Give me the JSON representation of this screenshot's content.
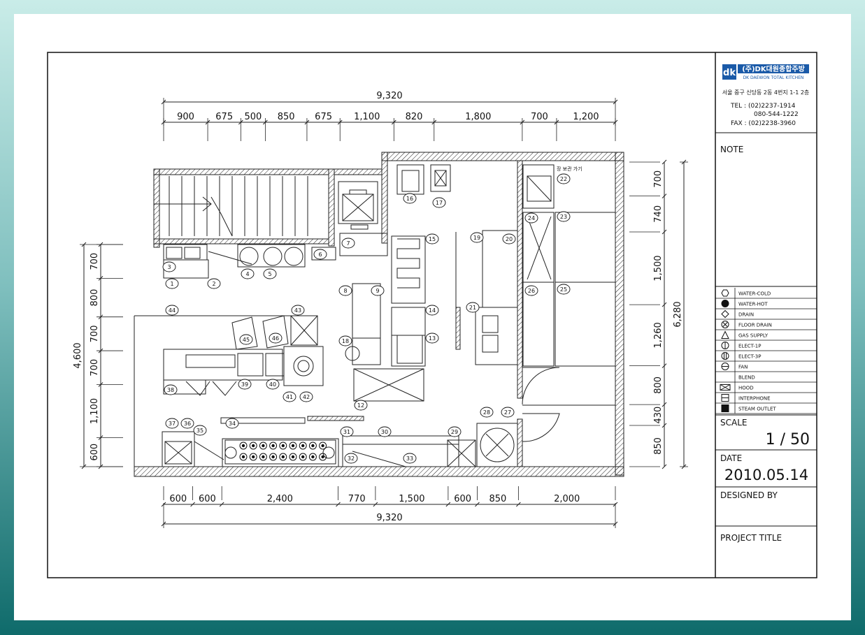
{
  "company": {
    "logo_mark": "dk",
    "name_ko": "(주)DK대원종합주방",
    "name_en": "DK DAEWON TOTAL KITCHEN",
    "address": "서울 중구 신당동 2동 4번지 1-1 2층",
    "tel": "TEL : (02)2237-1914",
    "tel2": "080-544-1222",
    "fax": "FAX : (02)2238-3960"
  },
  "note_label": "NOTE",
  "legend": [
    {
      "symbol": "hexagon",
      "label": "WATER-COLD"
    },
    {
      "symbol": "filled-circle",
      "label": "WATER-HOT"
    },
    {
      "symbol": "diamond",
      "label": "DRAIN"
    },
    {
      "symbol": "circle-x",
      "label": "FLOOR DRAIN"
    },
    {
      "symbol": "triangle",
      "label": "GAS SUPPLY"
    },
    {
      "symbol": "circle-bar",
      "label": "ELECT-1P"
    },
    {
      "symbol": "circle-bar-2",
      "label": "ELECT-3P"
    },
    {
      "symbol": "circle-line",
      "label": "FAN"
    },
    {
      "symbol": "blank",
      "label": "BLEND"
    },
    {
      "symbol": "box-x",
      "label": "HOOD"
    },
    {
      "symbol": "box-lines",
      "label": "INTERPHONE"
    },
    {
      "symbol": "filled-box",
      "label": "STEAM OUTLET"
    }
  ],
  "scale_label": "SCALE",
  "scale_value": "1 / 50",
  "date_label": "DATE",
  "date_value": "2010.05.14",
  "designed_label": "DESIGNED BY",
  "project_label": "PROJECT TITLE",
  "plan": {
    "top_total": "9,320",
    "top_dims": [
      "900",
      "675",
      "500",
      "850",
      "675",
      "1,100",
      "820",
      "1,800",
      "700",
      "1,200"
    ],
    "bottom_total": "9,320",
    "bottom_dims": [
      "600",
      "600",
      "2,400",
      "770",
      "1,500",
      "600",
      "850",
      "2,000"
    ],
    "left_total": "4,600",
    "left_dims": [
      "700",
      "800",
      "700",
      "700",
      "1,100",
      "600"
    ],
    "right_total": "6,280",
    "right_dims": [
      "700",
      "740",
      "1,500",
      "1,260",
      "800",
      "430",
      "850"
    ],
    "area_label": "장 보관 가기",
    "tags": [
      "1",
      "2",
      "3",
      "4",
      "5",
      "6",
      "7",
      "8",
      "9",
      "12",
      "13",
      "14",
      "15",
      "16",
      "17",
      "18",
      "19",
      "20",
      "21",
      "22",
      "23",
      "24",
      "25",
      "26",
      "27",
      "28",
      "29",
      "30",
      "31",
      "32",
      "33",
      "34",
      "35",
      "36",
      "37",
      "38",
      "39",
      "40",
      "41",
      "42",
      "43",
      "44",
      "45",
      "46"
    ]
  }
}
